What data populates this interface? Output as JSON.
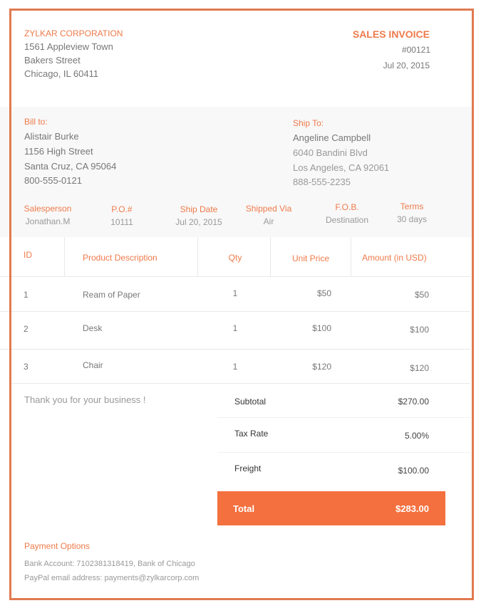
{
  "company": {
    "name": "ZYLKAR CORPORATION",
    "address": [
      "1561 Appleview Town",
      "Bakers Street",
      "Chicago, IL 60411"
    ]
  },
  "invoice": {
    "title": "SALES INVOICE",
    "number": "#00121",
    "date": "Jul 20, 2015"
  },
  "bill_to": {
    "label": "Bill to:",
    "name": "Alistair Burke",
    "lines": [
      "1156 High Street",
      "Santa Cruz, CA 95064",
      "800-555-0121"
    ]
  },
  "ship_to": {
    "label": "Ship To:",
    "name": "Angeline Campbell",
    "lines": [
      "6040 Bandini Blvd",
      "Los Angeles, CA 92061",
      "888-555-2235"
    ]
  },
  "meta": [
    {
      "label": "Salesperson",
      "value": "Jonathan.M"
    },
    {
      "label": "P.O.#",
      "value": "10111"
    },
    {
      "label": "Ship Date",
      "value": "Jul 20, 2015"
    },
    {
      "label": "Shipped Via",
      "value": "Air"
    },
    {
      "label": "F.O.B.",
      "value": "Destination"
    },
    {
      "label": "Terms",
      "value": "30 days"
    }
  ],
  "table": {
    "headers": [
      "ID",
      "Product Description",
      "Qty",
      "Unit Price",
      "Amount (in USD)"
    ],
    "rows": [
      [
        "1",
        "Ream of Paper",
        "1",
        "$50",
        "$50"
      ],
      [
        "2",
        "Desk",
        "1",
        "$100",
        "$100"
      ],
      [
        "3",
        "Chair",
        "1",
        "$120",
        "$120"
      ]
    ]
  },
  "thanks": "Thank you for your business !",
  "summary": [
    {
      "label": "Subtotal",
      "value": "$270.00"
    },
    {
      "label": "Tax Rate",
      "value": "5.00%"
    },
    {
      "label": "Freight",
      "value": "$100.00"
    }
  ],
  "total": {
    "label": "Total",
    "value": "$283.00"
  },
  "payment": {
    "title": "Payment Options",
    "lines": [
      "Bank Account: 7102381318419, Bank of Chicago",
      "PayPal email address: payments@zylkarcorp.com"
    ]
  },
  "colors": {
    "accent": "#ef7a4a",
    "border": "#e07a4f",
    "total_bg": "#f4703e"
  }
}
